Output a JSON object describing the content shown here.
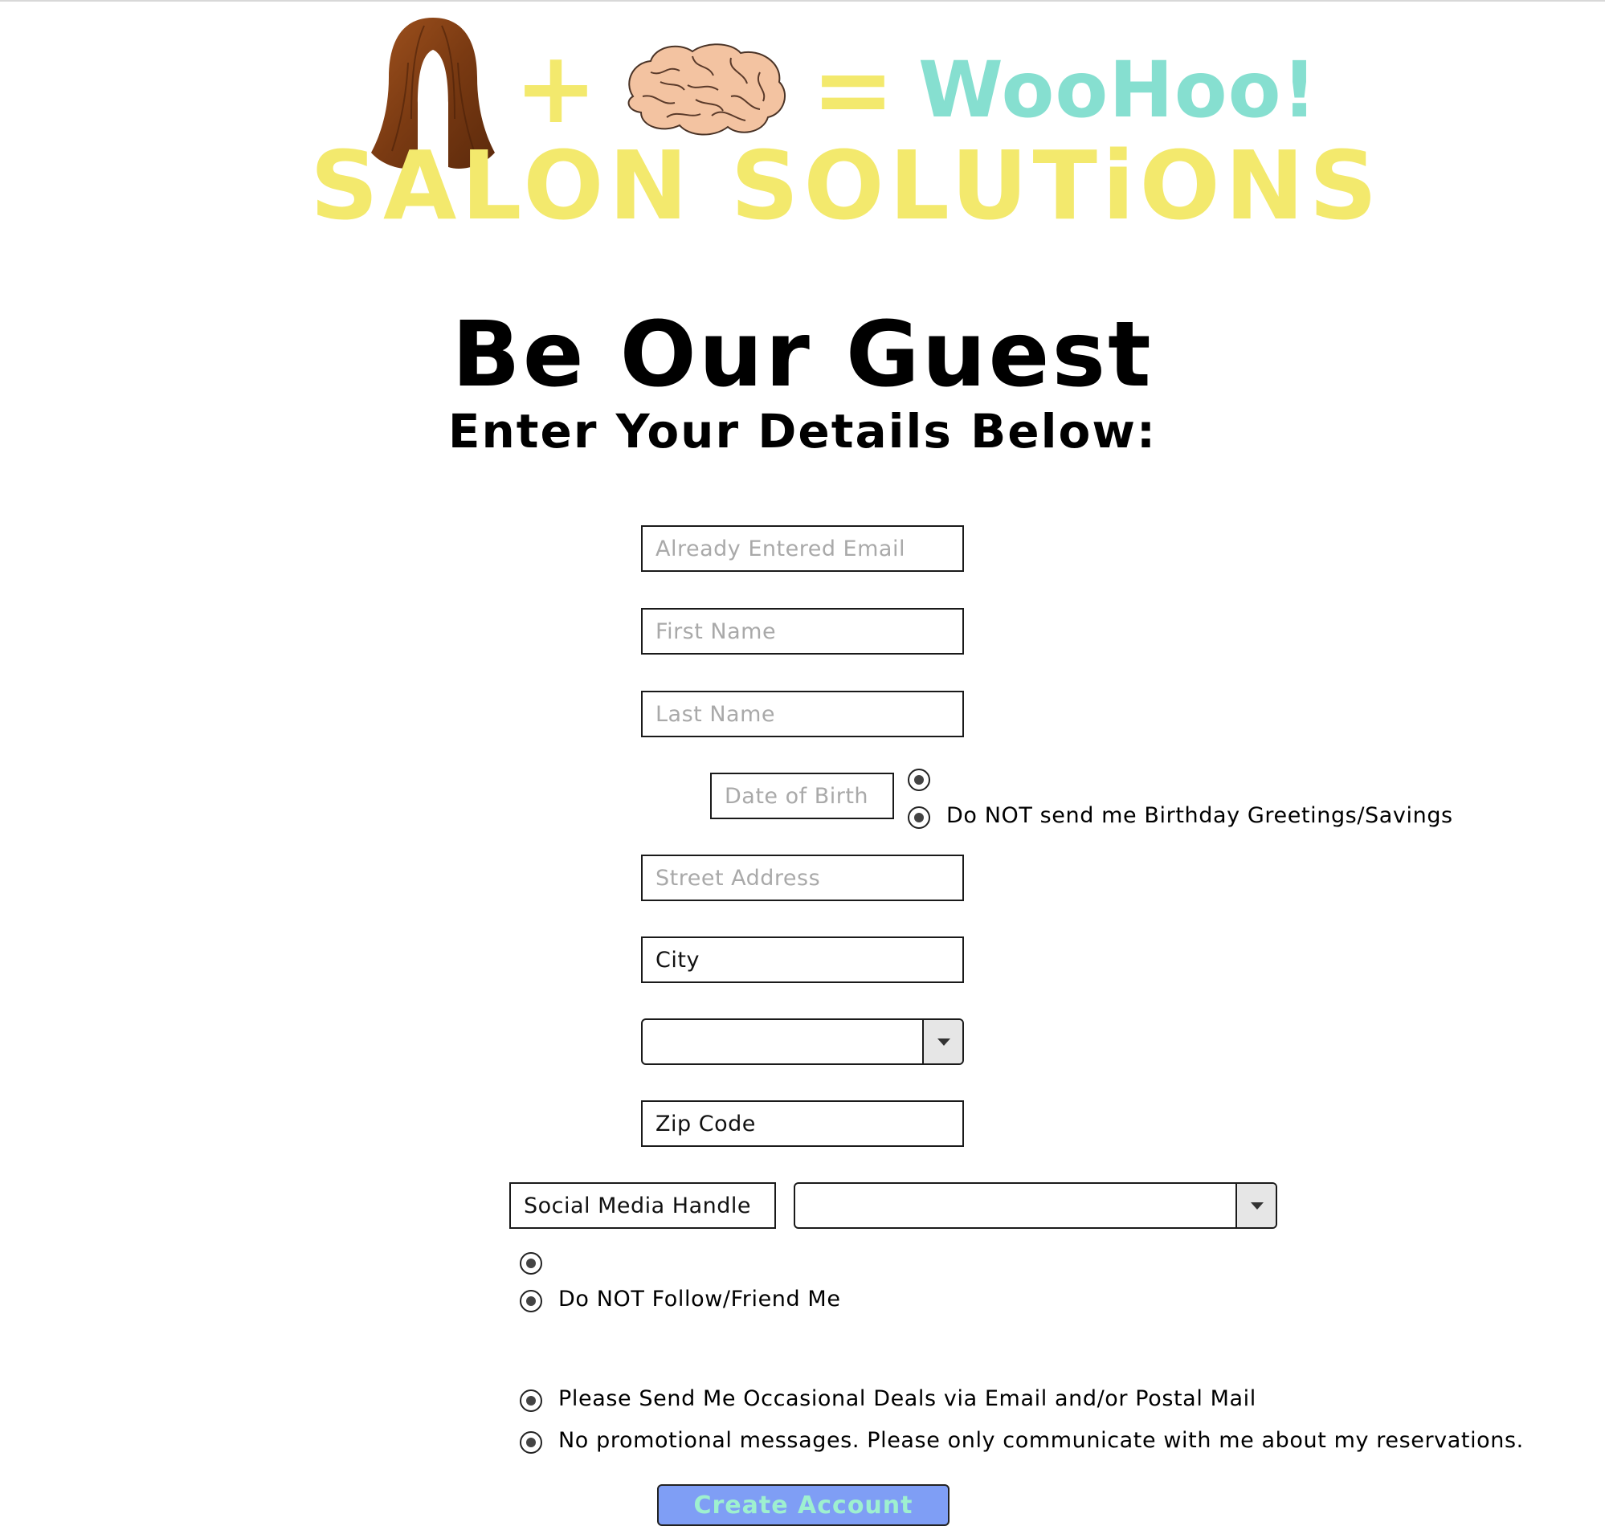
{
  "header": {
    "hair_image": "wig-hair-image",
    "plus_sign": "+",
    "brain_image": "brain-image",
    "equals_sign": "=",
    "exclamation": "WooHoo!",
    "brand_name": "SALON SOLUTiONS"
  },
  "page": {
    "title": "Be Our Guest",
    "subtitle": "Enter Your Details Below:"
  },
  "form": {
    "email_placeholder": "Already Entered Email",
    "first_name_placeholder": "First Name",
    "last_name_placeholder": "Last Name",
    "dob_placeholder": "Date of Birth",
    "birthday_opt_out_label": "Do NOT send me Birthday Greetings/Savings",
    "street_placeholder": "Street Address",
    "city_value": "City",
    "state_selected": "",
    "zip_value": "Zip Code",
    "social_handle_value": "Social Media Handle",
    "social_platform_selected": "",
    "social_opt_out_label": "Do NOT Follow/Friend Me",
    "deals_opt_in_label": "Please Send Me Occasional Deals via Email and/or Postal Mail",
    "deals_opt_out_label": "No promotional messages.  Please only communicate with me about my reservations.",
    "submit_label": "Create Account"
  },
  "colors": {
    "brand_yellow": "#f3e96d",
    "woohoo_teal": "#86dfd0",
    "button_blue": "#7f9ef5",
    "button_text": "#9ef0cf"
  }
}
